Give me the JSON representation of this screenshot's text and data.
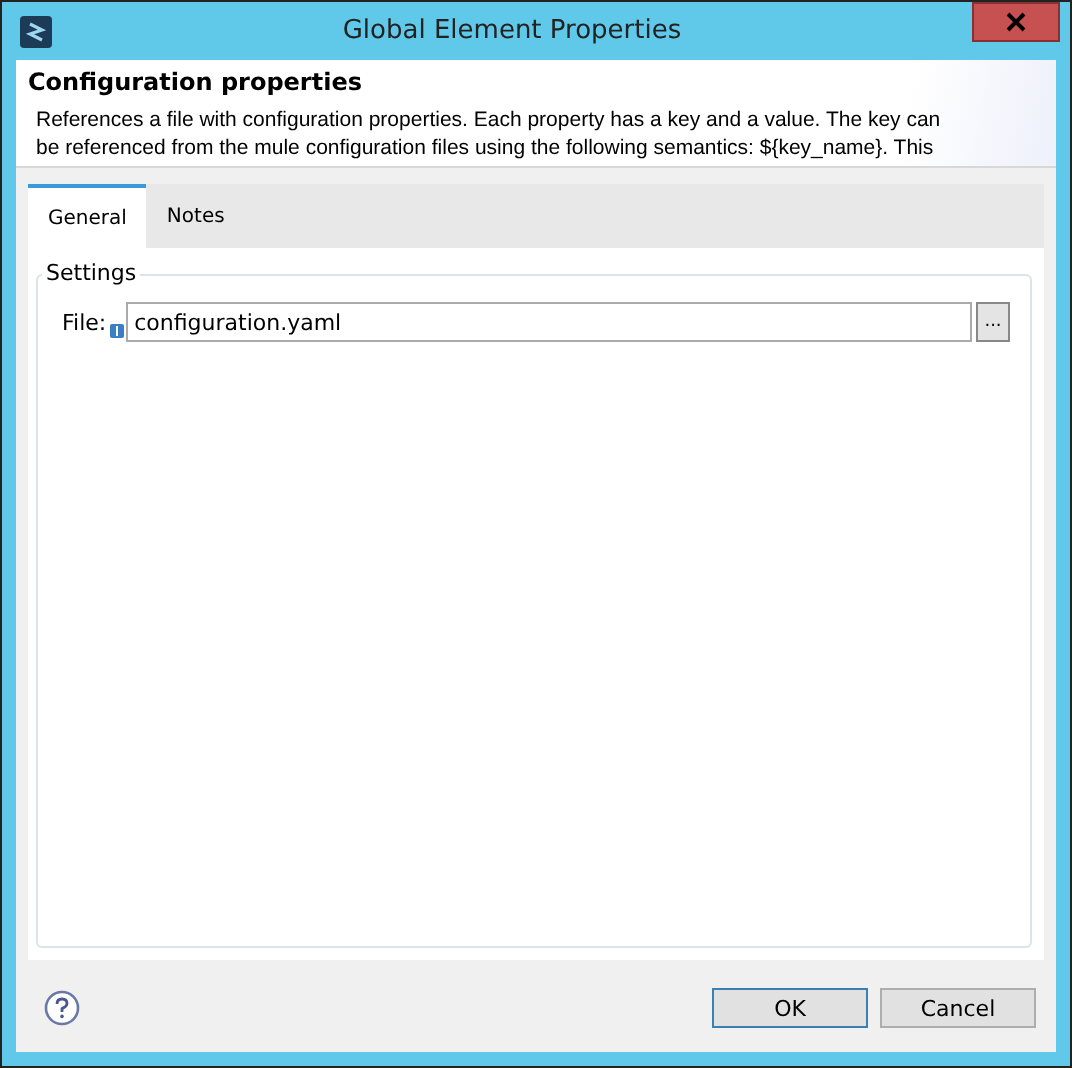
{
  "window": {
    "title": "Global Element Properties"
  },
  "header": {
    "title": "Configuration properties",
    "description": "References a file with configuration properties. Each property has a key and a value. The key can be referenced from the mule configuration files using the following semantics: ${key_name}. This"
  },
  "tabs": [
    {
      "label": "General",
      "selected": true
    },
    {
      "label": "Notes",
      "selected": false
    }
  ],
  "settings": {
    "label": "Settings",
    "field": {
      "label": "File:",
      "value": "configuration.yaml",
      "browse": "..."
    }
  },
  "buttons": [
    {
      "label": "OK",
      "default": true
    },
    {
      "label": "Cancel",
      "default": false
    }
  ]
}
